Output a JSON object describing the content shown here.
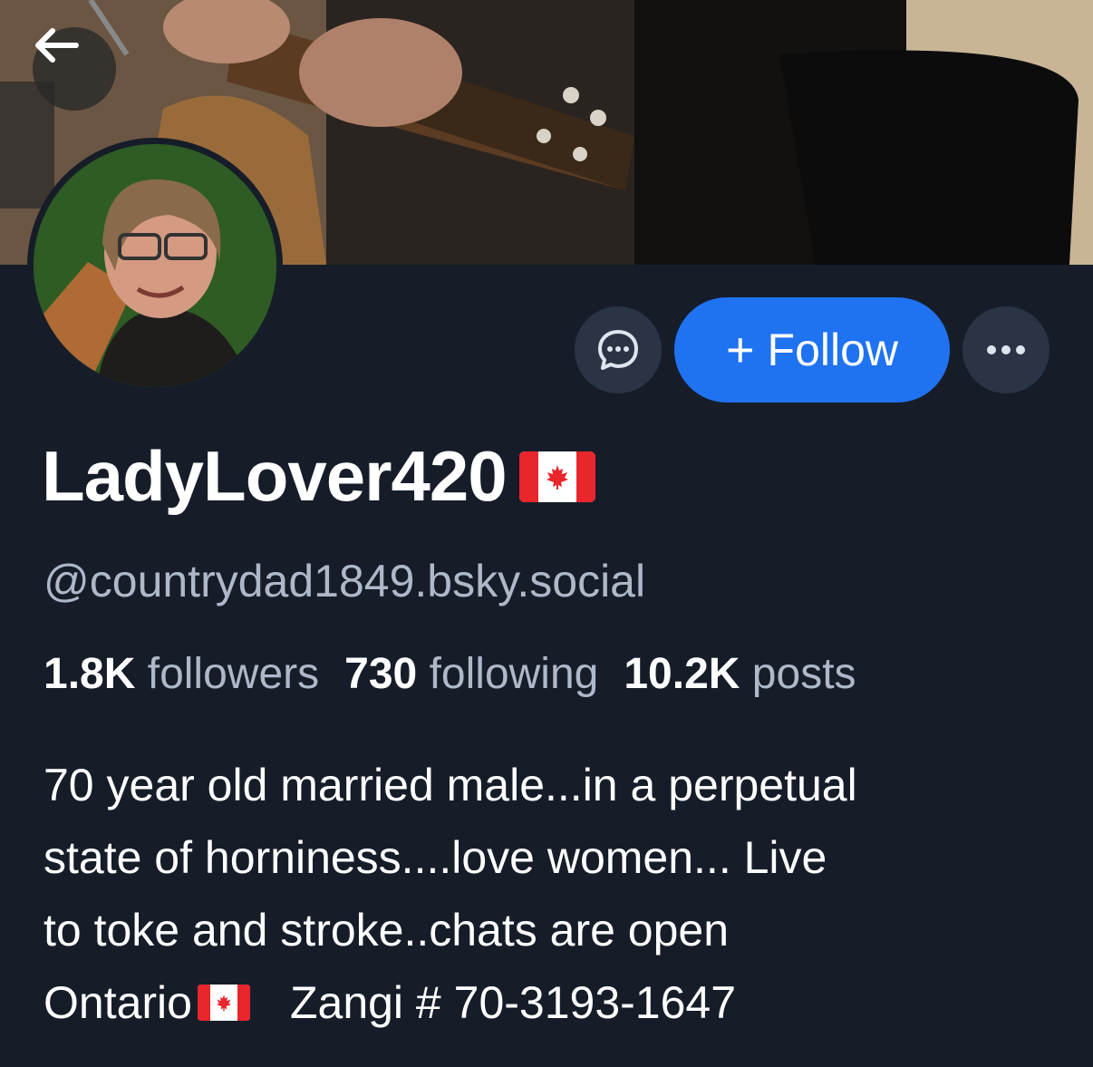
{
  "profile": {
    "display_name": "LadyLover420",
    "handle": "@countrydad1849.bsky.social",
    "stats": {
      "followers_count": "1.8K",
      "followers_label": "followers",
      "following_count": "730",
      "following_label": "following",
      "posts_count": "10.2K",
      "posts_label": "posts"
    },
    "bio": {
      "line1": "70 year old married male...in a perpetual",
      "line2": "state of horniness....love women... Live",
      "line3": "to toke and stroke..chats are open",
      "line4_a": "Ontario",
      "line4_b": "Zangi # 70-3193-1647"
    }
  },
  "actions": {
    "follow_plus": "+",
    "follow_label": "Follow"
  },
  "icons": {
    "back": "arrow-left-icon",
    "message": "chat-bubble-icon",
    "more": "ellipsis-icon",
    "flag": "canada-flag-icon"
  },
  "colors": {
    "background": "#161d29",
    "accent": "#1f72f0",
    "muted_text": "#aeb8c8",
    "button_bg": "#2b3445"
  }
}
